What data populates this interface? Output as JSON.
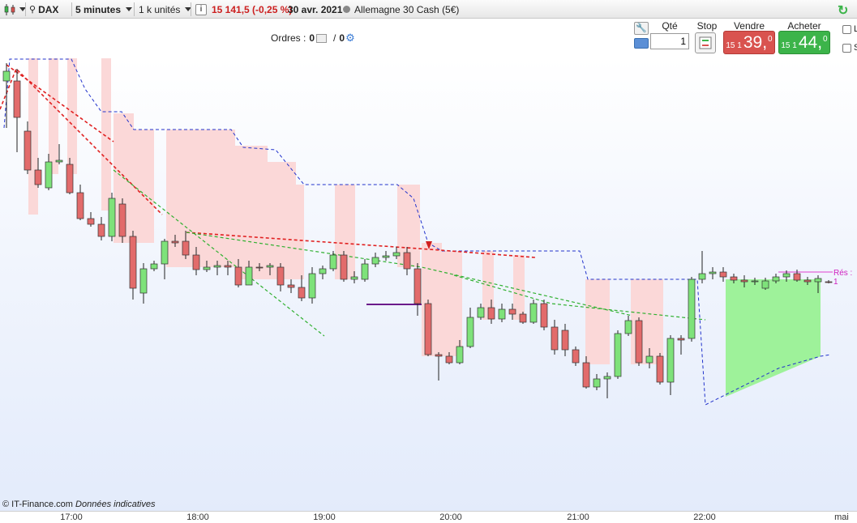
{
  "toolbar": {
    "instrument": "DAX",
    "timeframe": "5 minutes",
    "units": "1 k unités",
    "info_icon": "i",
    "price_change": "15 141,5 (-0,25 %)",
    "date": "30 avr. 2021",
    "market": "Allemagne 30 Cash (5€)"
  },
  "orders": {
    "label": "Ordres :",
    "count1": "0",
    "separator": "/",
    "count2": "0"
  },
  "trade": {
    "qty_label": "Qté",
    "qty_value": "1",
    "stop_label": "Stop",
    "sell_label": "Vendre",
    "buy_label": "Acheter",
    "sell_small": "15 1",
    "sell_big": "39,",
    "sell_sup": "0",
    "buy_small": "15 1",
    "buy_big": "44,",
    "buy_sup": "0"
  },
  "side": {
    "label1": "L",
    "label2": "S"
  },
  "chart": {
    "credit": "© IT-Finance.com",
    "credit_note": "Données indicatives",
    "res_label": "Rés : 1",
    "time_labels": [
      "17:00",
      "18:00",
      "19:00",
      "20:00",
      "21:00",
      "22:00",
      "mai"
    ],
    "colors": {
      "up": "#7ee27a",
      "down": "#e26b6b",
      "bear_zone": "#fbd8d8",
      "bull_zone": "#9ef29a",
      "stop_line": "#2233cc",
      "red_trend": "#e02020",
      "green_trend": "#30b030"
    }
  }
}
